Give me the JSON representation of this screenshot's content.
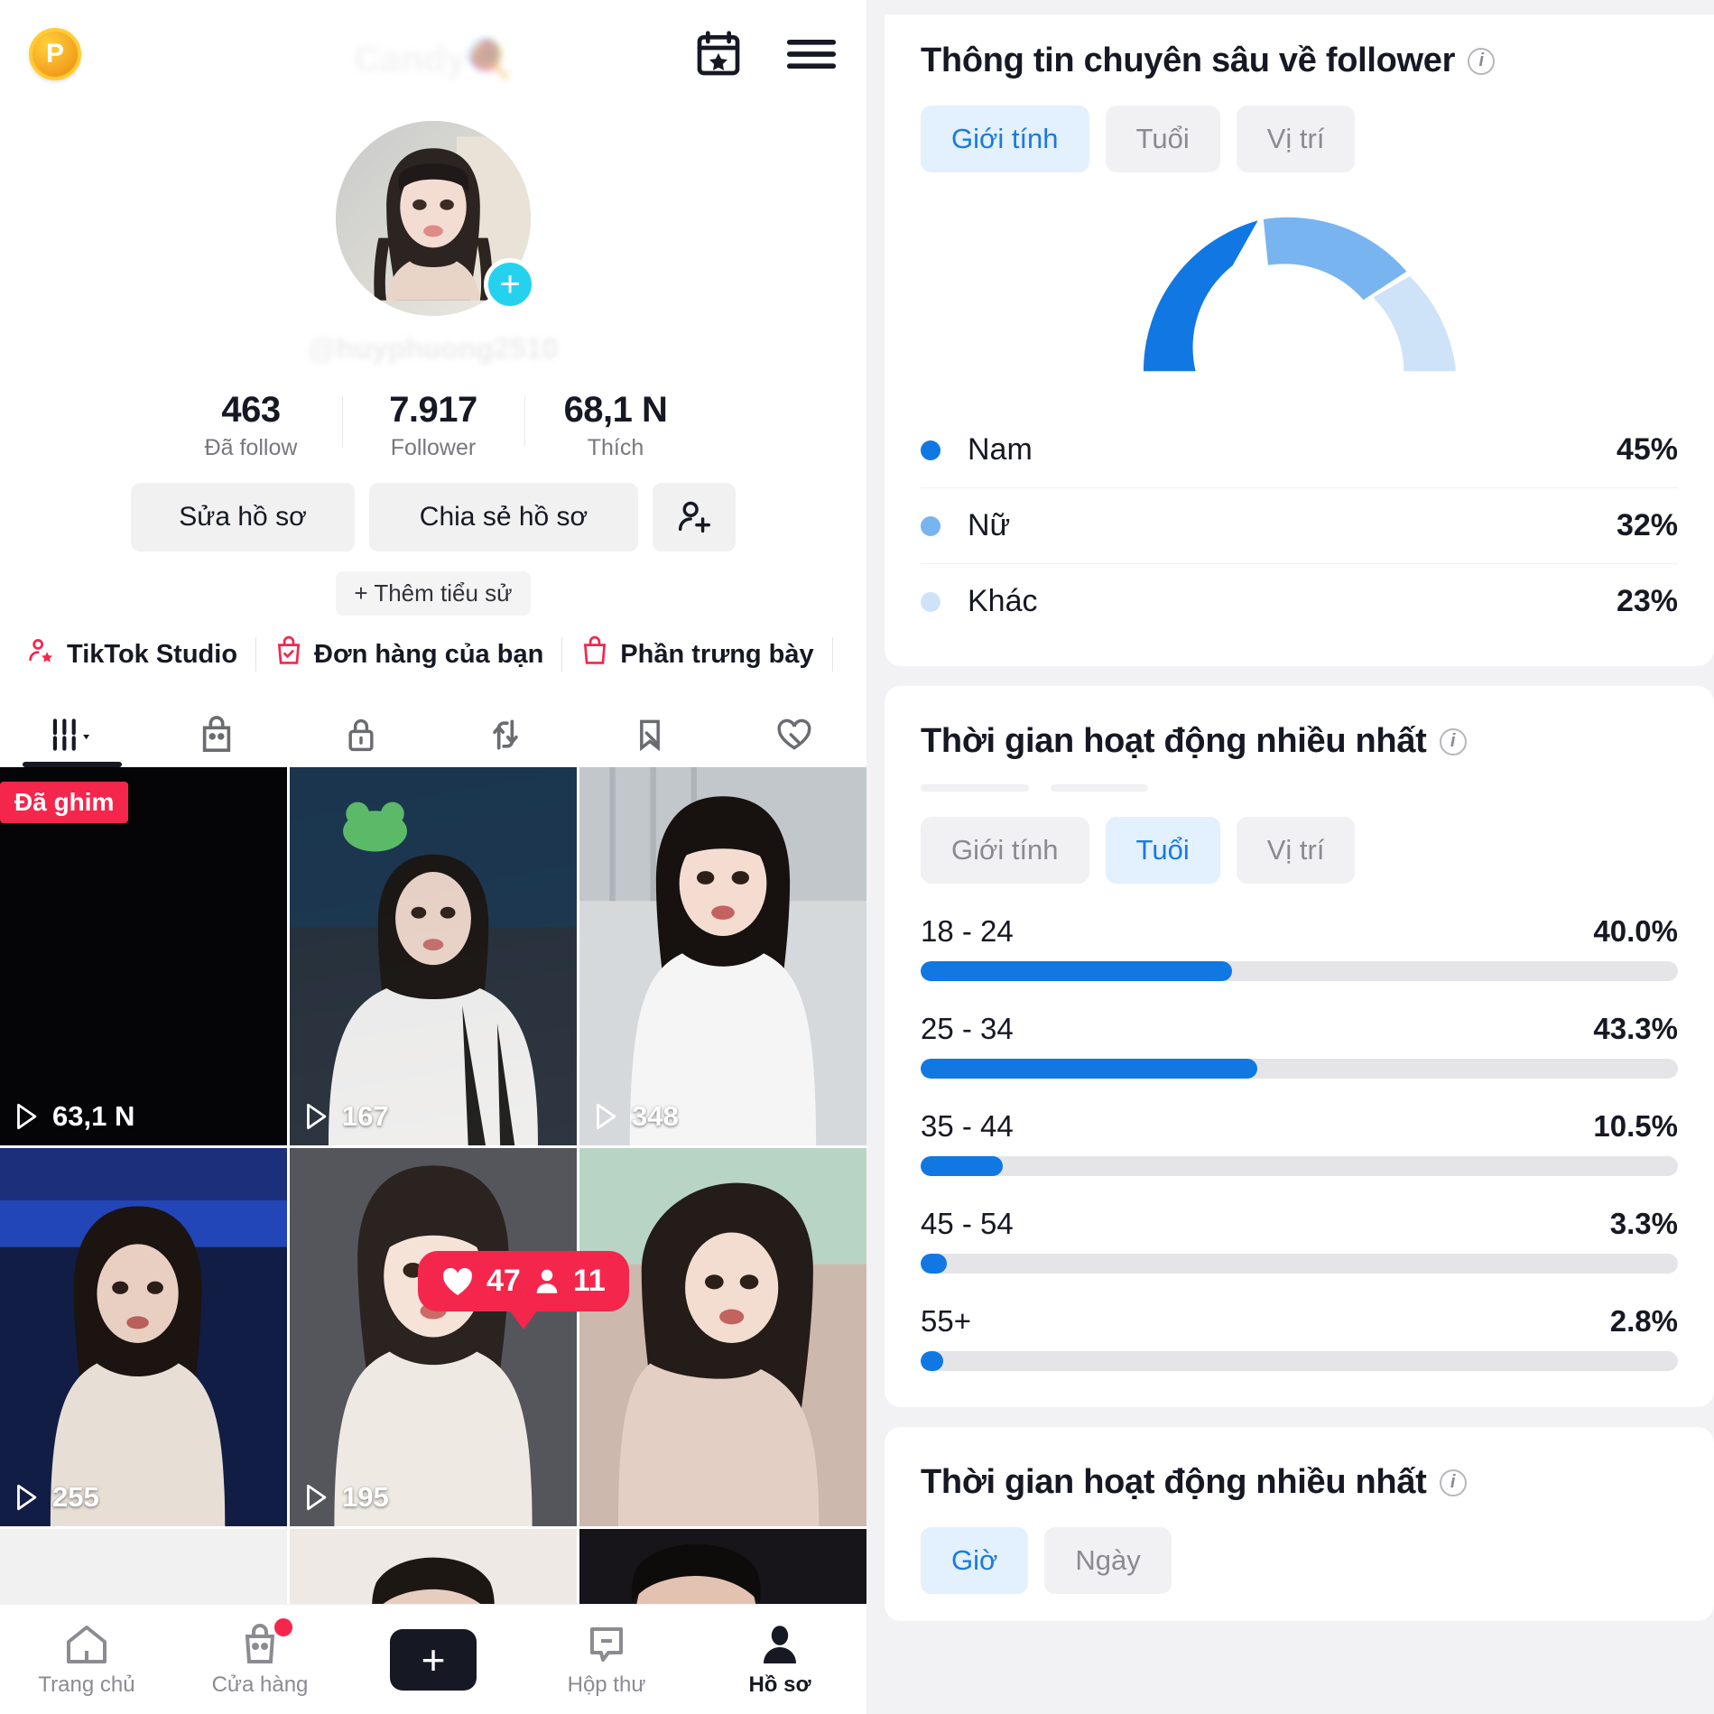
{
  "profile": {
    "coin_badge": "P",
    "header_title": "Candy🍭",
    "username": "@huyphuong2510",
    "avatar_plus": "+",
    "stats": [
      {
        "value": "463",
        "label": "Đã follow"
      },
      {
        "value": "7.917",
        "label": "Follower"
      },
      {
        "value": "68,1 N",
        "label": "Thích"
      }
    ],
    "buttons": {
      "edit_profile": "Sửa hồ sơ",
      "share_profile": "Chia sẻ hồ sơ",
      "add_friend_icon": "add-friend-icon"
    },
    "add_bio": "+ Thêm tiểu sử",
    "shortcuts": [
      {
        "label": "TikTok Studio",
        "icon": "studio-person-star-icon"
      },
      {
        "label": "Đơn hàng của bạn",
        "icon": "order-bag-check-icon"
      },
      {
        "label": "Phần trưng bày",
        "icon": "showcase-bag-icon"
      }
    ],
    "content_tabs": [
      {
        "icon": "posts-grid-icon",
        "active": true
      },
      {
        "icon": "shop-bag-icon",
        "active": false
      },
      {
        "icon": "lock-private-icon",
        "active": false
      },
      {
        "icon": "repost-arrows-icon",
        "active": false
      },
      {
        "icon": "bookmark-off-icon",
        "active": false
      },
      {
        "icon": "heart-off-icon",
        "active": false
      }
    ],
    "videos": [
      {
        "views": "63,1 N",
        "pinned_label": "Đã ghim"
      },
      {
        "views": "167"
      },
      {
        "views": "348"
      },
      {
        "views": "255"
      },
      {
        "views": "195"
      },
      {
        "views": ""
      }
    ],
    "like_bubble": {
      "likes": "47",
      "viewers": "11"
    },
    "bottom_nav": [
      {
        "label": "Trang chủ",
        "icon": "home-icon",
        "active": false,
        "badge": false
      },
      {
        "label": "Cửa hàng",
        "icon": "shop-icon",
        "active": false,
        "badge": true
      },
      {
        "label": "",
        "icon": "create-plus-icon",
        "active": false,
        "badge": false
      },
      {
        "label": "Hộp thư",
        "icon": "inbox-icon",
        "active": false,
        "badge": false
      },
      {
        "label": "Hồ sơ",
        "icon": "profile-icon",
        "active": true,
        "badge": false
      }
    ]
  },
  "analytics": {
    "follower_insights": {
      "title": "Thông tin chuyên sâu về follower",
      "info_icon": "info-icon",
      "tabs": [
        {
          "label": "Giới tính",
          "active": true
        },
        {
          "label": "Tuổi",
          "active": false
        },
        {
          "label": "Vị trí",
          "active": false
        }
      ]
    },
    "most_active_age": {
      "title": "Thời gian hoạt động nhiều nhất",
      "info_icon": "info-icon",
      "tabs": [
        {
          "label": "Giới tính",
          "active": false
        },
        {
          "label": "Tuổi",
          "active": true
        },
        {
          "label": "Vị trí",
          "active": false
        }
      ]
    },
    "most_active_time": {
      "title": "Thời gian hoạt động nhiều nhất",
      "info_icon": "info-icon",
      "tabs": [
        {
          "label": "Giờ",
          "active": true
        },
        {
          "label": "Ngày",
          "active": false
        }
      ]
    }
  },
  "colors": {
    "accent_blue": "#1178e3",
    "gauge_dark": "#1178e3",
    "gauge_mid": "#78b4ef",
    "gauge_light": "#cfe3f8",
    "pill_active_bg": "#e3f0fd",
    "pill_active_text": "#1b7ae0",
    "brand_red": "#f5264c",
    "track_gray": "#e5e5e8"
  },
  "chart_data": [
    {
      "type": "pie",
      "title": "Thông tin chuyên sâu về follower",
      "subtitle": "Giới tính",
      "shape": "semicircle-donut",
      "labels": [
        "Nam",
        "Nữ",
        "Khác"
      ],
      "values": [
        45,
        32,
        23
      ],
      "value_labels": [
        "45%",
        "32%",
        "23%"
      ],
      "colors": [
        "#1178e3",
        "#78b4ef",
        "#cfe3f8"
      ],
      "legend": "below",
      "unit": "%"
    },
    {
      "type": "bar",
      "orientation": "horizontal",
      "title": "Thời gian hoạt động nhiều nhất",
      "subtitle": "Tuổi",
      "categories": [
        "18 - 24",
        "25 - 34",
        "35 - 44",
        "45 - 54",
        "55+"
      ],
      "values": [
        40.0,
        43.3,
        10.5,
        3.3,
        2.8
      ],
      "value_labels": [
        "40.0%",
        "43.3%",
        "10.5%",
        "3.3%",
        "2.8%"
      ],
      "xlabel": "",
      "ylabel": "",
      "xlim": [
        0,
        43.3
      ],
      "grid": false,
      "bar_color": "#1178e3",
      "track_color": "#e5e5e8"
    }
  ]
}
